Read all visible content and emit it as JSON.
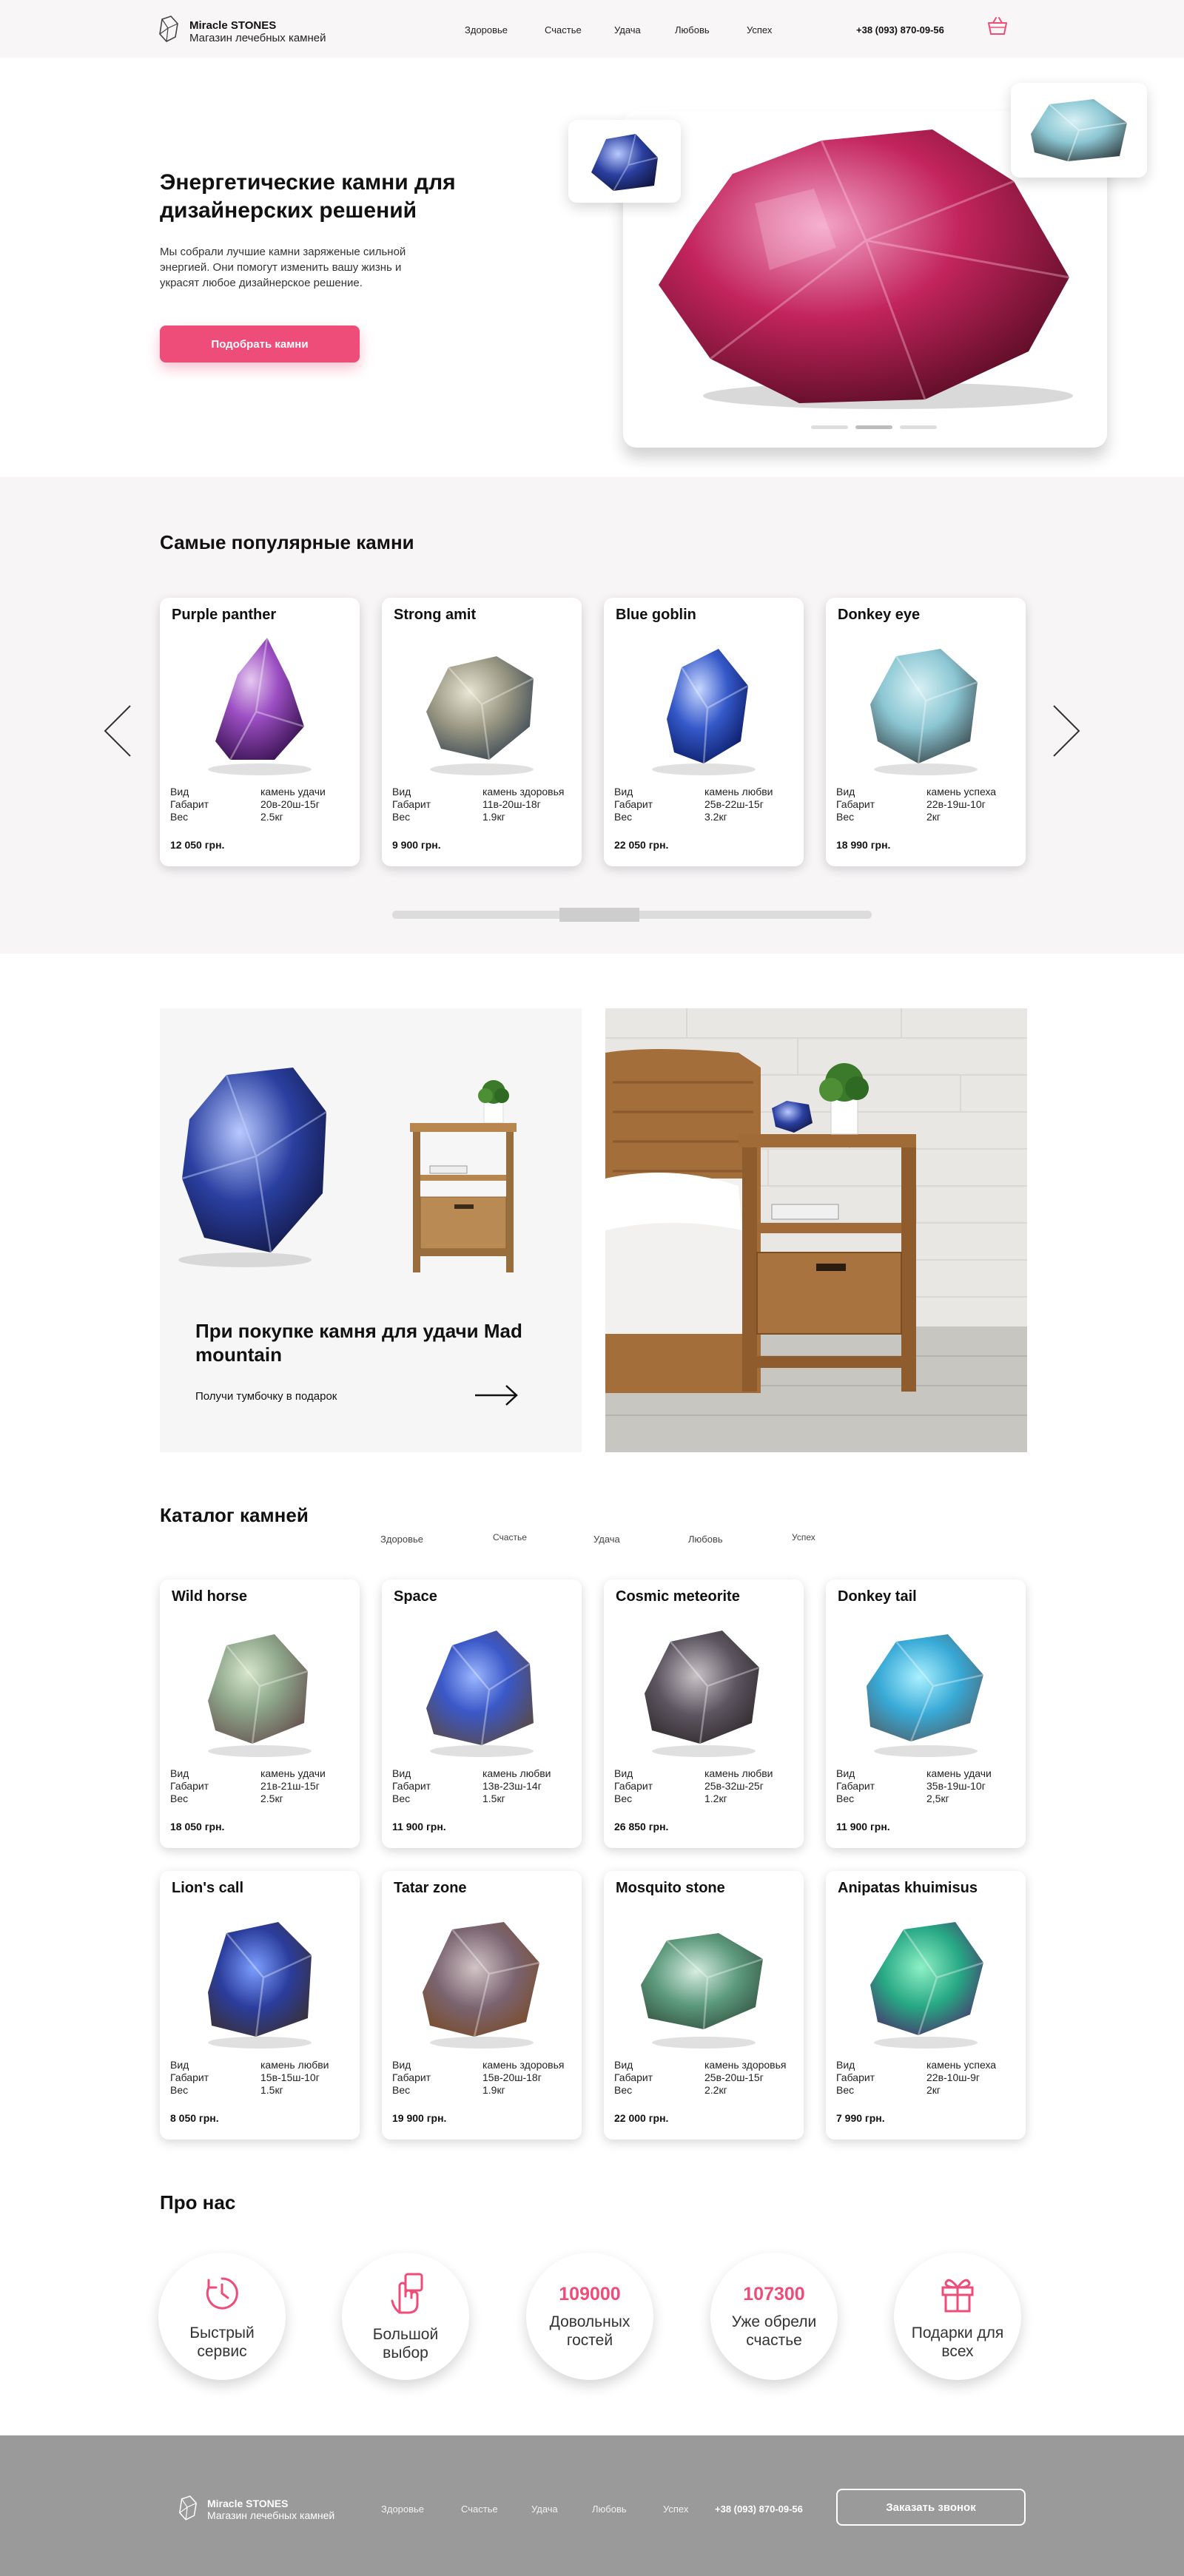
{
  "header": {
    "brand_title": "Miracle STONES",
    "brand_subtitle": "Магазин лечебных камней",
    "nav": [
      "Здоровье",
      "Счастье",
      "Удача",
      "Любовь",
      "Успех"
    ],
    "phone": "+38 (093) 870-09-56",
    "cart_icon": "cart-icon"
  },
  "hero": {
    "title": "Энергетические камни для дизайнерских решений",
    "text": "Мы собрали лучшие камни заряженые сильной энергией. Они помогут изменить вашу жизнь и украсят любое дизайнерское решение.",
    "button": "Подобрать камни",
    "slides_total": 3,
    "slide_active": 2
  },
  "popular": {
    "title": "Самые популярные камни",
    "spec_labels": [
      "Вид",
      "Габарит",
      "Вес"
    ],
    "cards": [
      {
        "name": "Purple panther",
        "kind": "камень удачи",
        "size": "20в-20ш-15г",
        "weight": "2.5кг",
        "price": "12 050 грн."
      },
      {
        "name": "Strong amit",
        "kind": "камень здоровья",
        "size": "11в-20ш-18г",
        "weight": "1.9кг",
        "price": "9 900 грн."
      },
      {
        "name": "Blue goblin",
        "kind": "камень любви",
        "size": "25в-22ш-15г",
        "weight": "3.2кг",
        "price": "22 050 грн."
      },
      {
        "name": "Donkey eye",
        "kind": "камень успеха",
        "size": "22в-19ш-10г",
        "weight": "2кг",
        "price": "18 990 грн."
      }
    ]
  },
  "promo": {
    "title": "При покупке камня для удачи Mad mountain",
    "text": "Получи тумбочку в подарок"
  },
  "catalog": {
    "title": "Каталог камней",
    "tabs": [
      "Здоровье",
      "Счастье",
      "Удача",
      "Любовь",
      "Успех"
    ],
    "spec_labels": [
      "Вид",
      "Габарит",
      "Вес"
    ],
    "cards": [
      {
        "name": "Wild horse",
        "kind": "камень удачи",
        "size": "21в-21ш-15г",
        "weight": "2.5кг",
        "price": "18 050 грн."
      },
      {
        "name": "Space",
        "kind": "камень любви",
        "size": "13в-23ш-14г",
        "weight": "1.5кг",
        "price": "11 900 грн."
      },
      {
        "name": "Cosmic meteorite",
        "kind": "камень любви",
        "size": "25в-32ш-25г",
        "weight": "1.2кг",
        "price": "26 850 грн."
      },
      {
        "name": "Donkey tail",
        "kind": "камень удачи",
        "size": "35в-19ш-10г",
        "weight": "2,5кг",
        "price": "11 900 грн."
      },
      {
        "name": "Lion's call",
        "kind": "камень любви",
        "size": "15в-15ш-10г",
        "weight": "1.5кг",
        "price": "8 050 грн."
      },
      {
        "name": "Tatar zone",
        "kind": "камень здоровья",
        "size": "15в-20ш-18г",
        "weight": "1.9кг",
        "price": "19 900 грн."
      },
      {
        "name": "Mosquito stone",
        "kind": "камень здоровья",
        "size": "25в-20ш-15г",
        "weight": "2.2кг",
        "price": "22 000 грн."
      },
      {
        "name": "Anipatas khuimisus",
        "kind": "камень успеха",
        "size": "22в-10ш-9г",
        "weight": "2кг",
        "price": "7 990 грн."
      }
    ]
  },
  "about": {
    "title": "Про нас",
    "items": [
      {
        "icon": "timer-icon",
        "number": "",
        "label": "Быстрый сервис"
      },
      {
        "icon": "hand-click-icon",
        "number": "",
        "label": "Большой выбор"
      },
      {
        "icon": "",
        "number": "109000",
        "label": "Довольных гостей"
      },
      {
        "icon": "",
        "number": "107300",
        "label": "Уже обрели счастье"
      },
      {
        "icon": "gift-icon",
        "number": "",
        "label": "Подарки для всех"
      }
    ]
  },
  "footer": {
    "brand_title": "Miracle STONES",
    "brand_subtitle": "Магазин лечебных камней",
    "nav": [
      "Здоровье",
      "Счастье",
      "Удача",
      "Любовь",
      "Успех"
    ],
    "phone": "+38 (093) 870-09-56",
    "callback": "Заказать звонок"
  },
  "colors": {
    "accent": "#ef4d79",
    "footer_bg": "#9a9a9a",
    "section_bg": "#f7f5f6"
  }
}
